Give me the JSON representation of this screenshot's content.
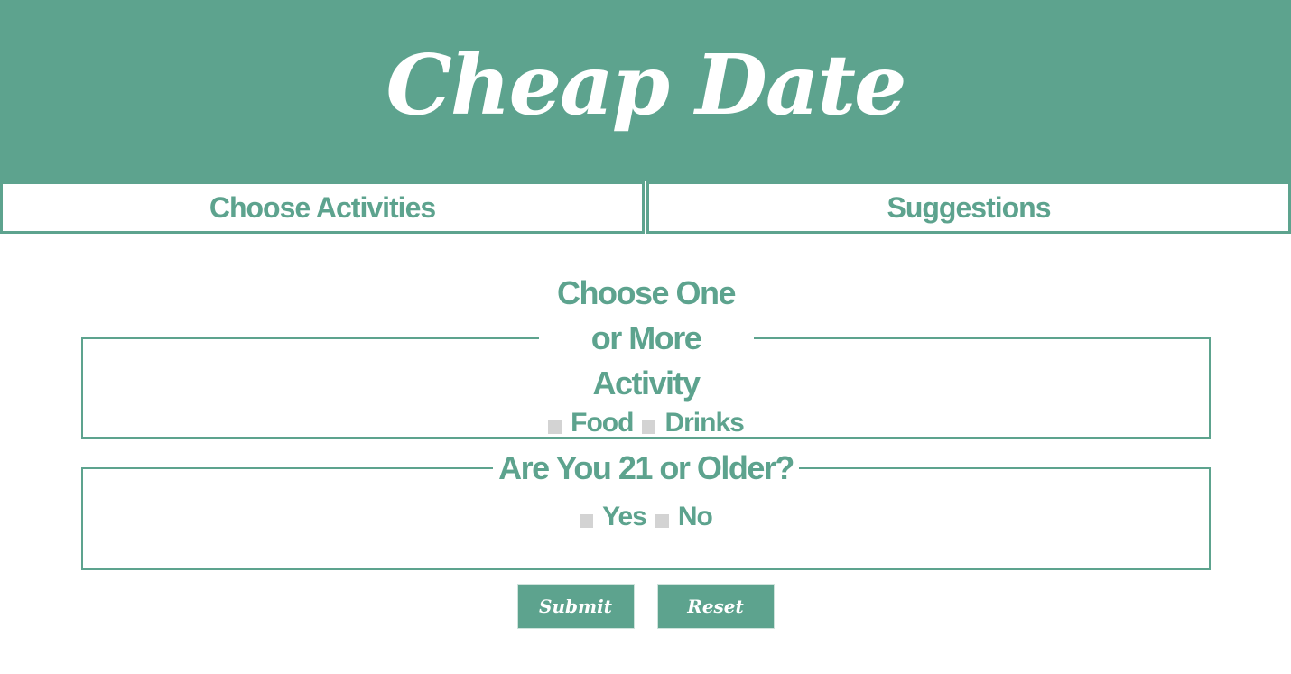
{
  "header": {
    "title": "Cheap Date"
  },
  "nav": {
    "tabs": [
      {
        "label": "Choose Activities"
      },
      {
        "label": "Suggestions"
      }
    ]
  },
  "activity_section": {
    "legend": "Choose One or More Activity",
    "options": [
      {
        "label": "Food",
        "checked": false
      },
      {
        "label": "Drinks",
        "checked": false
      }
    ]
  },
  "age_section": {
    "legend": "Are You 21 or Older?",
    "options": [
      {
        "label": "Yes",
        "checked": false
      },
      {
        "label": "No",
        "checked": false
      }
    ]
  },
  "buttons": {
    "submit_label": "Submit",
    "reset_label": "Reset"
  },
  "colors": {
    "brand": "#5da38e",
    "checkbox": "#d3d3d3",
    "background": "#ffffff"
  }
}
